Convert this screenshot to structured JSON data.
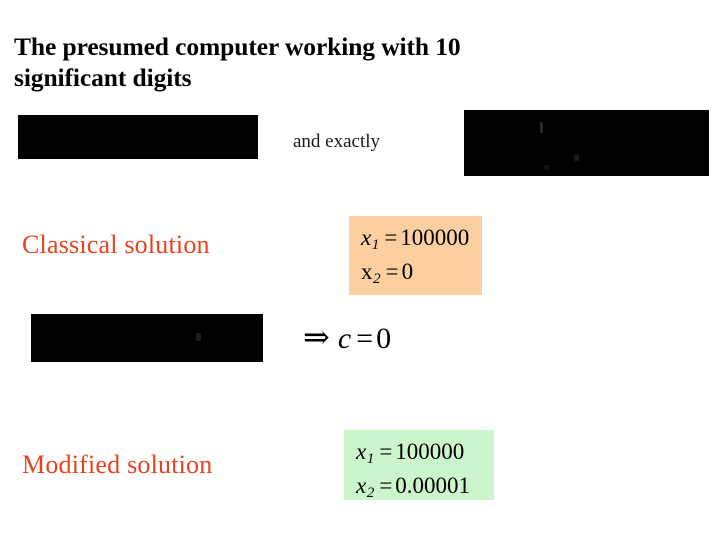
{
  "slide": {
    "title": "The presumed computer working with 10 significant digits",
    "background_color": "#ffffff"
  },
  "inline_text": {
    "and_exactly": "and exactly"
  },
  "labels": {
    "classical_solution": "Classical solution",
    "modified_solution": "Modified solution",
    "color": "#e8431f"
  },
  "redactions": [
    {
      "name": "redaction-top-left",
      "label": ""
    },
    {
      "name": "redaction-top-right",
      "label": ""
    },
    {
      "name": "redaction-mid-left",
      "label": ""
    }
  ],
  "math": {
    "classical": {
      "background_color": "#fbcfa0",
      "line1": {
        "var": "x",
        "sub": "1",
        "eq": "=",
        "value": "100000"
      },
      "line2": {
        "var": "x",
        "sub": "2",
        "eq": "=",
        "value": "0"
      }
    },
    "modified": {
      "background_color": "#ccf5cc",
      "line1": {
        "var": "x",
        "sub": "1",
        "eq": "=",
        "value": "100000"
      },
      "line2": {
        "var": "x",
        "sub": "2",
        "eq": "=",
        "value": "0.00001"
      }
    },
    "implication": {
      "arrow": "⇒",
      "var": "c",
      "eq": "=",
      "value": "0"
    }
  }
}
